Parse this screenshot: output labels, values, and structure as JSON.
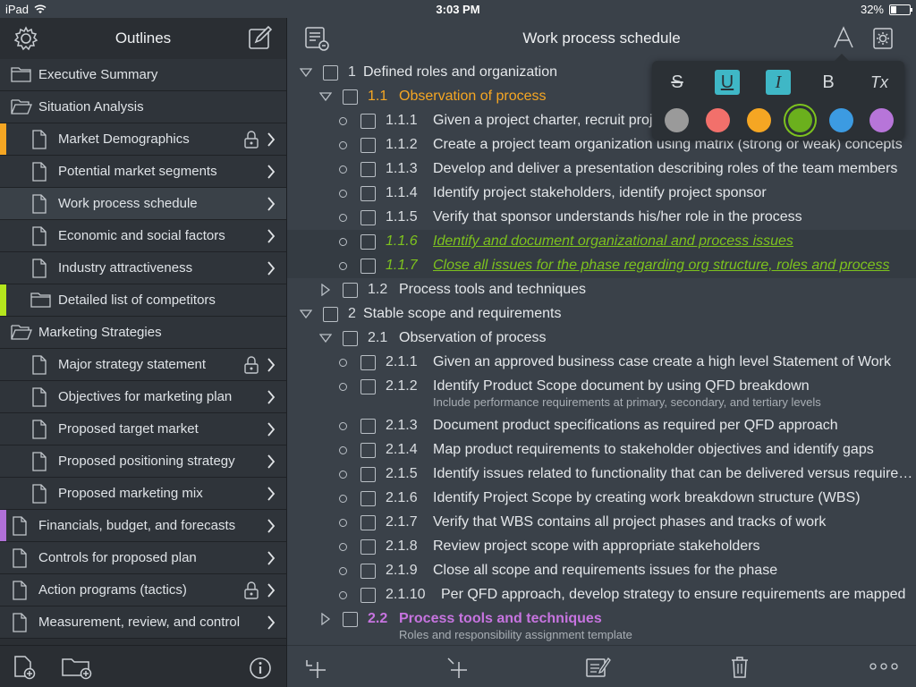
{
  "status": {
    "device": "iPad",
    "time": "3:03 PM",
    "battery": "32%",
    "battery_level": 0.32
  },
  "sidebar": {
    "title": "Outlines",
    "items": [
      {
        "label": "Executive Summary",
        "kind": "folder",
        "level": 0,
        "chevron": false,
        "lock": false,
        "mark": null
      },
      {
        "label": "Situation Analysis",
        "kind": "folder-open",
        "level": 0,
        "chevron": false,
        "lock": false,
        "mark": null
      },
      {
        "label": "Market Demographics",
        "kind": "doc",
        "level": 1,
        "chevron": true,
        "lock": true,
        "mark": "#f5a623"
      },
      {
        "label": "Potential market segments",
        "kind": "doc",
        "level": 1,
        "chevron": true,
        "lock": false,
        "mark": null
      },
      {
        "label": "Work process schedule",
        "kind": "doc",
        "level": 1,
        "chevron": true,
        "lock": false,
        "mark": null,
        "selected": true
      },
      {
        "label": "Economic and social factors",
        "kind": "doc",
        "level": 1,
        "chevron": true,
        "lock": false,
        "mark": null
      },
      {
        "label": "Industry attractiveness",
        "kind": "doc",
        "level": 1,
        "chevron": true,
        "lock": false,
        "mark": null
      },
      {
        "label": "Detailed list of competitors",
        "kind": "folder",
        "level": 1,
        "chevron": false,
        "lock": false,
        "mark": "#b5e61d"
      },
      {
        "label": "Marketing Strategies",
        "kind": "folder-open",
        "level": 0,
        "chevron": false,
        "lock": false,
        "mark": null
      },
      {
        "label": "Major strategy statement",
        "kind": "doc",
        "level": 1,
        "chevron": true,
        "lock": true,
        "mark": null
      },
      {
        "label": "Objectives for marketing plan",
        "kind": "doc",
        "level": 1,
        "chevron": true,
        "lock": false,
        "mark": null
      },
      {
        "label": "Proposed target market",
        "kind": "doc",
        "level": 1,
        "chevron": true,
        "lock": false,
        "mark": null
      },
      {
        "label": "Proposed positioning strategy",
        "kind": "doc",
        "level": 1,
        "chevron": true,
        "lock": false,
        "mark": null
      },
      {
        "label": "Proposed marketing mix",
        "kind": "doc",
        "level": 1,
        "chevron": true,
        "lock": false,
        "mark": null
      },
      {
        "label": "Financials, budget, and forecasts",
        "kind": "doc",
        "level": 0,
        "chevron": true,
        "lock": false,
        "mark": "#b070d8"
      },
      {
        "label": "Controls for proposed plan",
        "kind": "doc",
        "level": 0,
        "chevron": true,
        "lock": false,
        "mark": null
      },
      {
        "label": "Action programs (tactics)",
        "kind": "doc",
        "level": 0,
        "chevron": true,
        "lock": true,
        "mark": null
      },
      {
        "label": "Measurement, review, and control",
        "kind": "doc",
        "level": 0,
        "chevron": true,
        "lock": false,
        "mark": null
      }
    ]
  },
  "main": {
    "title": "Work process schedule",
    "rows": [
      {
        "level": 0,
        "type": "tri-down",
        "num": "1",
        "text": "Defined roles and organization"
      },
      {
        "level": 1,
        "type": "tri-down",
        "num": "1.1",
        "text": "Observation of process",
        "style": "orange"
      },
      {
        "level": 2,
        "type": "bullet",
        "num": "1.1.1",
        "text": "Given a project charter, recruit project team"
      },
      {
        "level": 2,
        "type": "bullet",
        "num": "1.1.2",
        "text": "Create a project team organization using matrix (strong or weak) concepts"
      },
      {
        "level": 2,
        "type": "bullet",
        "num": "1.1.3",
        "text": "Develop and deliver a presentation describing roles of the team members"
      },
      {
        "level": 2,
        "type": "bullet",
        "num": "1.1.4",
        "text": "Identify project stakeholders, identify project sponsor"
      },
      {
        "level": 2,
        "type": "bullet",
        "num": "1.1.5",
        "text": "Verify that sponsor understands his/her role in the process"
      },
      {
        "level": 2,
        "type": "bullet",
        "num": "1.1.6",
        "text": "Identify and document organizational and process issues",
        "style": "green",
        "hl": true
      },
      {
        "level": 2,
        "type": "bullet",
        "num": "1.1.7",
        "text": "Close all issues for the phase regarding org structure, roles and process",
        "style": "green",
        "hl": true
      },
      {
        "level": 1,
        "type": "tri-right",
        "num": "1.2",
        "text": "Process tools and techniques"
      },
      {
        "level": 0,
        "type": "tri-down",
        "num": "2",
        "text": "Stable scope and requirements"
      },
      {
        "level": 1,
        "type": "tri-down",
        "num": "2.1",
        "text": "Observation of process"
      },
      {
        "level": 2,
        "type": "bullet",
        "num": "2.1.1",
        "text": "Given an approved business case create a high level Statement of Work"
      },
      {
        "level": 2,
        "type": "bullet",
        "num": "2.1.2",
        "text": "Identify Product Scope document by using QFD breakdown",
        "note": "Include performance requirements at primary, secondary, and tertiary levels"
      },
      {
        "level": 2,
        "type": "bullet",
        "num": "2.1.3",
        "text": "Document product specifications as required per QFD approach"
      },
      {
        "level": 2,
        "type": "bullet",
        "num": "2.1.4",
        "text": "Map product requirements to stakeholder objectives and identify gaps"
      },
      {
        "level": 2,
        "type": "bullet",
        "num": "2.1.5",
        "text": "Identify issues related to functionality that can be delivered versus require…"
      },
      {
        "level": 2,
        "type": "bullet",
        "num": "2.1.6",
        "text": "Identify Project Scope by creating work breakdown structure (WBS)"
      },
      {
        "level": 2,
        "type": "bullet",
        "num": "2.1.7",
        "text": "Verify that WBS contains all project phases and tracks of work"
      },
      {
        "level": 2,
        "type": "bullet",
        "num": "2.1.8",
        "text": "Review project scope with appropriate stakeholders"
      },
      {
        "level": 2,
        "type": "bullet",
        "num": "2.1.9",
        "text": "Close all scope and requirements issues for the phase"
      },
      {
        "level": 2,
        "type": "bullet",
        "num": "2.1.10",
        "text": "Per QFD approach, develop strategy to ensure requirements are mapped"
      },
      {
        "level": 1,
        "type": "tri-right",
        "num": "2.2",
        "text": "Process tools and techniques",
        "style": "purple",
        "note": "Roles and responsibility assignment template"
      }
    ]
  },
  "format_popover": {
    "buttons": [
      {
        "name": "strikethrough",
        "glyph": "S",
        "active": false
      },
      {
        "name": "underline",
        "glyph": "U",
        "active": true
      },
      {
        "name": "italic",
        "glyph": "I",
        "active": true
      },
      {
        "name": "bold",
        "glyph": "B",
        "active": false
      },
      {
        "name": "clear-format",
        "glyph": "Tx",
        "active": false
      }
    ],
    "colors": [
      "#9a9a9a",
      "#f2706b",
      "#f5a623",
      "#6bb01d",
      "#3c9be2",
      "#b775d9"
    ],
    "selected_color": "#6bb01d"
  },
  "icons": {
    "sidebar_header": [
      "gear-icon",
      "compose-icon"
    ],
    "main_header": [
      "outline-list-icon",
      "font-icon",
      "settings-gear-icon"
    ],
    "sidebar_footer": [
      "new-document-icon",
      "new-folder-icon",
      "info-icon"
    ],
    "main_footer": [
      "add-sibling-icon",
      "add-child-icon",
      "notes-icon",
      "trash-icon",
      "more-icon"
    ]
  }
}
